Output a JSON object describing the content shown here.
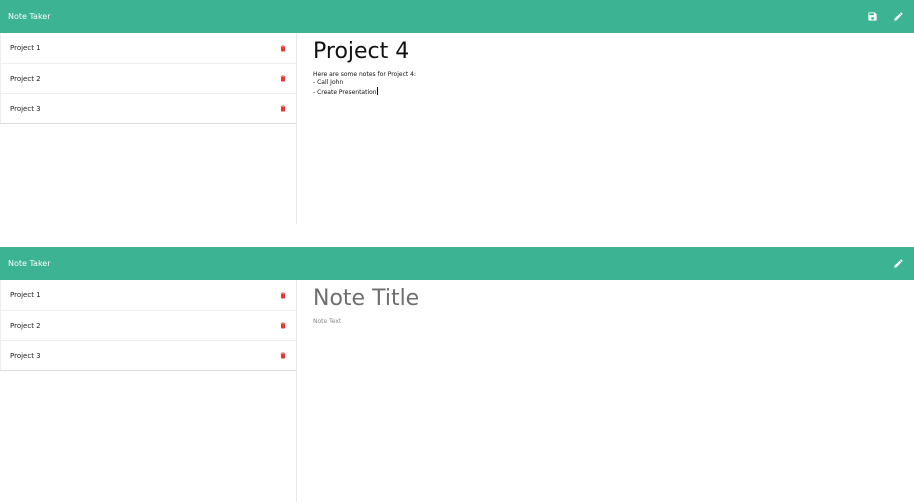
{
  "colors": {
    "accent": "#3cb393",
    "trash": "#e53935"
  },
  "screens": [
    {
      "brand": "Note Taker",
      "nav_icons": [
        "save-icon",
        "pencil-icon"
      ],
      "notes": [
        {
          "label": "Project 1",
          "icon": "trash-icon"
        },
        {
          "label": "Project 2",
          "icon": "trash-icon"
        },
        {
          "label": "Project 3",
          "icon": "trash-icon"
        }
      ],
      "editor": {
        "title": "Project 4",
        "text": "Here are some notes for Project 4:\n- Call John\n- Create Presentation"
      }
    },
    {
      "brand": "Note Taker",
      "nav_icons": [
        "pencil-icon"
      ],
      "notes": [
        {
          "label": "Project 1",
          "icon": "trash-icon"
        },
        {
          "label": "Project 2",
          "icon": "trash-icon"
        },
        {
          "label": "Project 3",
          "icon": "trash-icon"
        }
      ],
      "editor": {
        "title_placeholder": "Note Title",
        "text_placeholder": "Note Text"
      }
    }
  ]
}
